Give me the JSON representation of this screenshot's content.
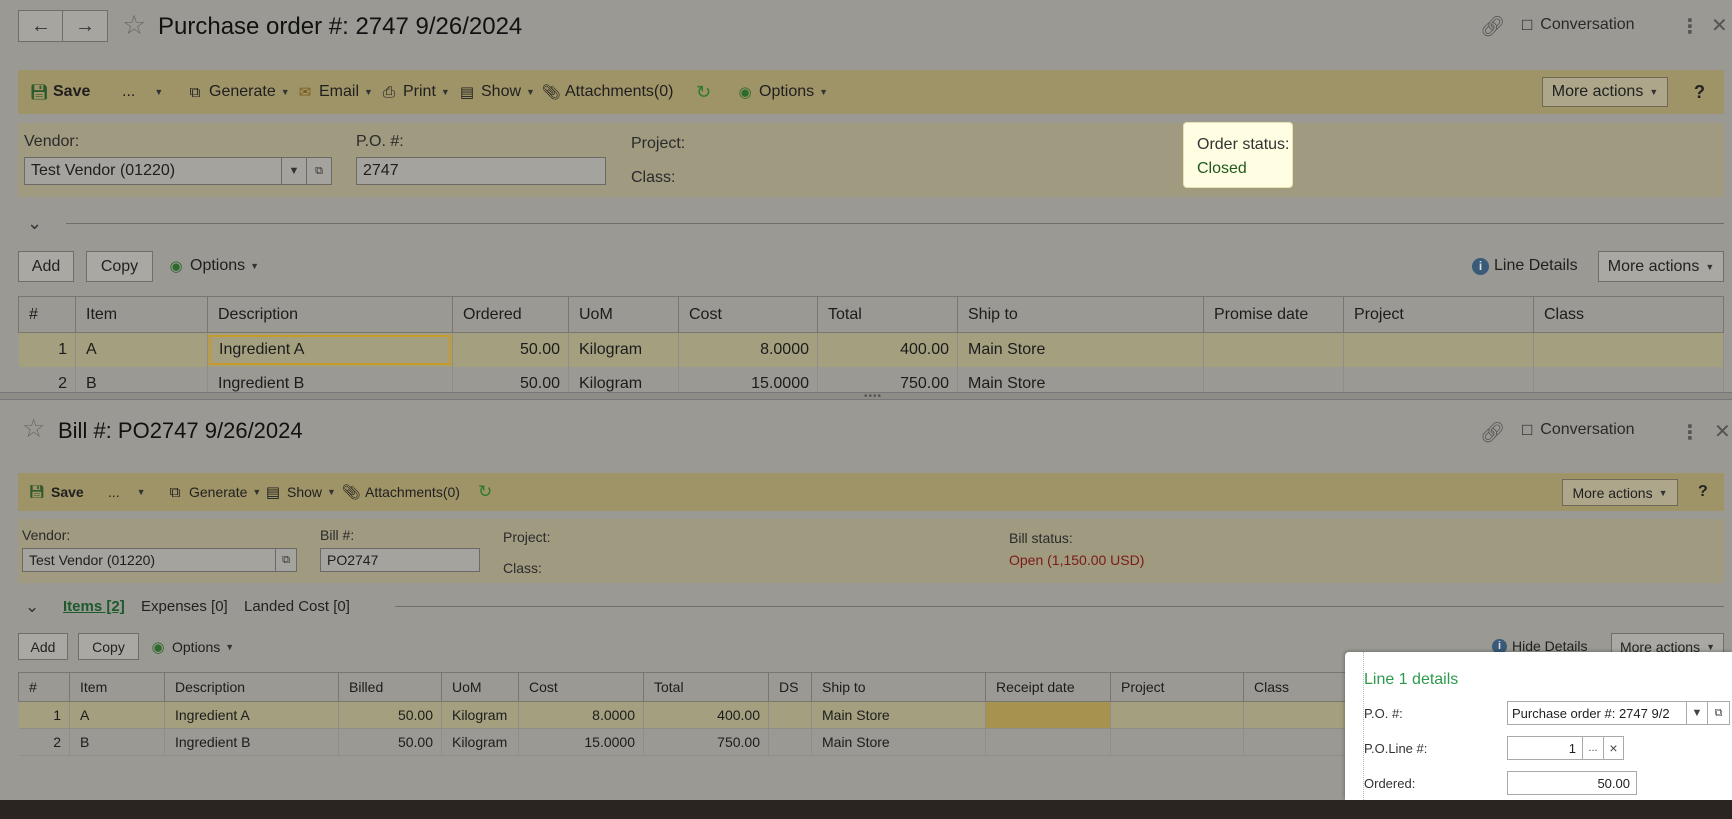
{
  "po": {
    "title": "Purchase order #: 2747 9/26/2024",
    "conversation": "Conversation",
    "toolbar": {
      "save": "Save",
      "ellipsis": "...",
      "generate": "Generate",
      "email": "Email",
      "print": "Print",
      "show": "Show",
      "attachments": "Attachments(0)",
      "options": "Options",
      "more_actions": "More actions",
      "help": "?"
    },
    "vendor_label": "Vendor:",
    "vendor_value": "Test Vendor (01220)",
    "po_label": "P.O. #:",
    "po_value": "2747",
    "project_label": "Project:",
    "class_label": "Class:",
    "status_label": "Order status:",
    "status_value": "Closed",
    "grid_toolbar": {
      "add": "Add",
      "copy": "Copy",
      "options": "Options",
      "line_details": "Line Details",
      "more_actions": "More actions"
    },
    "columns": [
      "#",
      "Item",
      "Description",
      "Ordered",
      "UoM",
      "Cost",
      "Total",
      "Ship to",
      "Promise date",
      "Project",
      "Class"
    ],
    "rows": [
      [
        "1",
        "A",
        "Ingredient A",
        "50.00",
        "Kilogram",
        "8.0000",
        "400.00",
        "Main Store",
        "",
        "",
        ""
      ],
      [
        "2",
        "B",
        "Ingredient B",
        "50.00",
        "Kilogram",
        "15.0000",
        "750.00",
        "Main Store",
        "",
        "",
        ""
      ]
    ]
  },
  "bill": {
    "title": "Bill #: PO2747 9/26/2024",
    "conversation": "Conversation",
    "toolbar": {
      "save": "Save",
      "ellipsis": "...",
      "generate": "Generate",
      "show": "Show",
      "attachments": "Attachments(0)",
      "more_actions": "More actions",
      "help": "?"
    },
    "vendor_label": "Vendor:",
    "vendor_value": "Test Vendor (01220)",
    "bill_label": "Bill #:",
    "bill_value": "PO2747",
    "project_label": "Project:",
    "class_label": "Class:",
    "status_label": "Bill status:",
    "status_value": "Open (1,150.00 USD)",
    "tabs": [
      "Items [2]",
      "Expenses [0]",
      "Landed Cost [0]"
    ],
    "grid_toolbar": {
      "add": "Add",
      "copy": "Copy",
      "options": "Options",
      "hide_details": "Hide Details",
      "more_actions": "More actions"
    },
    "columns": [
      "#",
      "Item",
      "Description",
      "Billed",
      "UoM",
      "Cost",
      "Total",
      "DS",
      "Ship to",
      "Receipt date",
      "Project",
      "Class"
    ],
    "rows": [
      [
        "1",
        "A",
        "Ingredient A",
        "50.00",
        "Kilogram",
        "8.0000",
        "400.00",
        "",
        "Main Store",
        "",
        "",
        ""
      ],
      [
        "2",
        "B",
        "Ingredient B",
        "50.00",
        "Kilogram",
        "15.0000",
        "750.00",
        "",
        "Main Store",
        "",
        "",
        ""
      ]
    ],
    "details": {
      "title": "Line 1 details",
      "po_label": "P.O. #:",
      "po_value": "Purchase order #: 2747 9/2",
      "line_label": "P.O.Line #:",
      "line_value": "1",
      "ordered_label": "Ordered:",
      "ordered_value": "50.00",
      "ellipsis": "...",
      "clear": "×"
    }
  },
  "colors": {
    "toolbar": "#9f9467",
    "selected_row": "#a49f7e",
    "status_closed": "#1e5a1e",
    "status_open": "#7a1a1a",
    "details_title": "#2e9a4e",
    "popup_bg": "#fffee3"
  }
}
